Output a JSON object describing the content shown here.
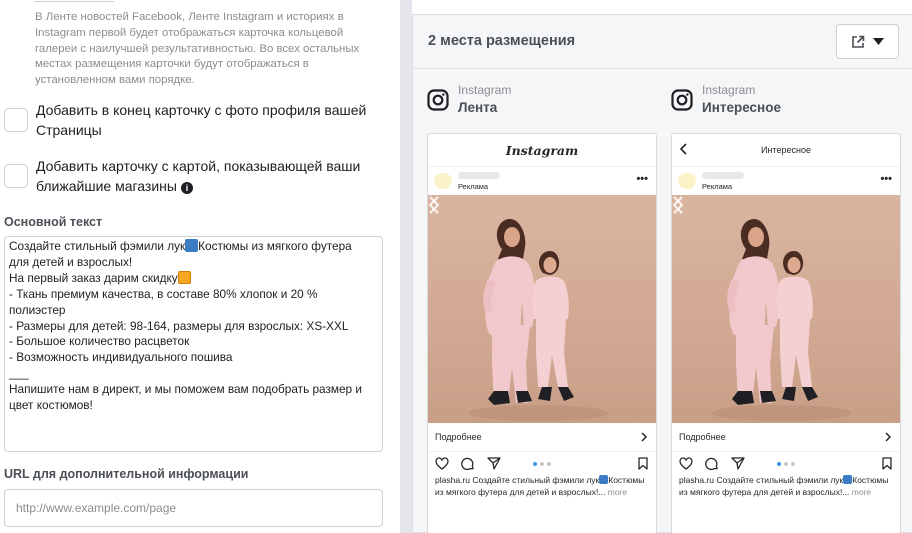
{
  "left": {
    "note": "В Ленте новостей Facebook, Ленте Instagram и историях в Instagram первой будет отображаться карточка кольцевой галереи с наилучшей результативностью. Во всех остальных местах размещения карточки будут отображаться в установленном вами порядке.",
    "checkbox_profile_card": "Добавить в конец карточку с фото профиля вашей Страницы",
    "checkbox_map_card": "Добавить карточку с картой, показывающей ваши ближайшие магазины",
    "primary_text_label": "Основной текст",
    "primary_text_lines": [
      {
        "pre": "Создайте стильный фэмили лук",
        "emoji": "shirt",
        "post": "Костюмы из мягкого футера"
      },
      {
        "pre": "для детей и взрослых!",
        "emoji": "",
        "post": ""
      },
      {
        "pre": " ",
        "emoji": "",
        "post": ""
      },
      {
        "pre": "На первый заказ дарим скидку",
        "emoji": "gift",
        "post": ""
      },
      {
        "pre": " ",
        "emoji": "",
        "post": ""
      },
      {
        "pre": "- Ткань премиум качества, в составе 80% хлопок и 20 %",
        "emoji": "",
        "post": ""
      },
      {
        "pre": "полиэстер",
        "emoji": "",
        "post": ""
      },
      {
        "pre": "- Размеры для детей: 98-164, размеры для взрослых: XS-XXL",
        "emoji": "",
        "post": ""
      },
      {
        "pre": "- Большое количество расцветок",
        "emoji": "",
        "post": ""
      },
      {
        "pre": "- Возможность индивидуального пошива",
        "emoji": "",
        "post": ""
      },
      {
        "pre": "___",
        "emoji": "",
        "post": ""
      },
      {
        "pre": "Напишите нам в директ, и мы поможем вам подобрать размер и",
        "emoji": "",
        "post": ""
      },
      {
        "pre": "цвет костюмов!",
        "emoji": "",
        "post": ""
      }
    ],
    "url_label": "URL для дополнительной информации",
    "url_placeholder": "http://www.example.com/page"
  },
  "preview": {
    "title": "2 места размещения",
    "placements": [
      {
        "platform": "Instagram",
        "name": "Лента",
        "header": "Instagram",
        "header_type": "logo"
      },
      {
        "platform": "Instagram",
        "name": "Интересное",
        "header": "Интересное",
        "header_type": "explore"
      }
    ],
    "sponsored": "Реклама",
    "learn_more": "Подробнее",
    "caption": "plasha.ru Создайте стильный фэмили лук",
    "caption_rest": "Костюмы из мягкого футера для детей и взрослых!...",
    "more": "more"
  },
  "colors": {
    "accent": "#3897f0",
    "photo_bg": "#d1a891",
    "outfit": "#f1c9cc"
  }
}
